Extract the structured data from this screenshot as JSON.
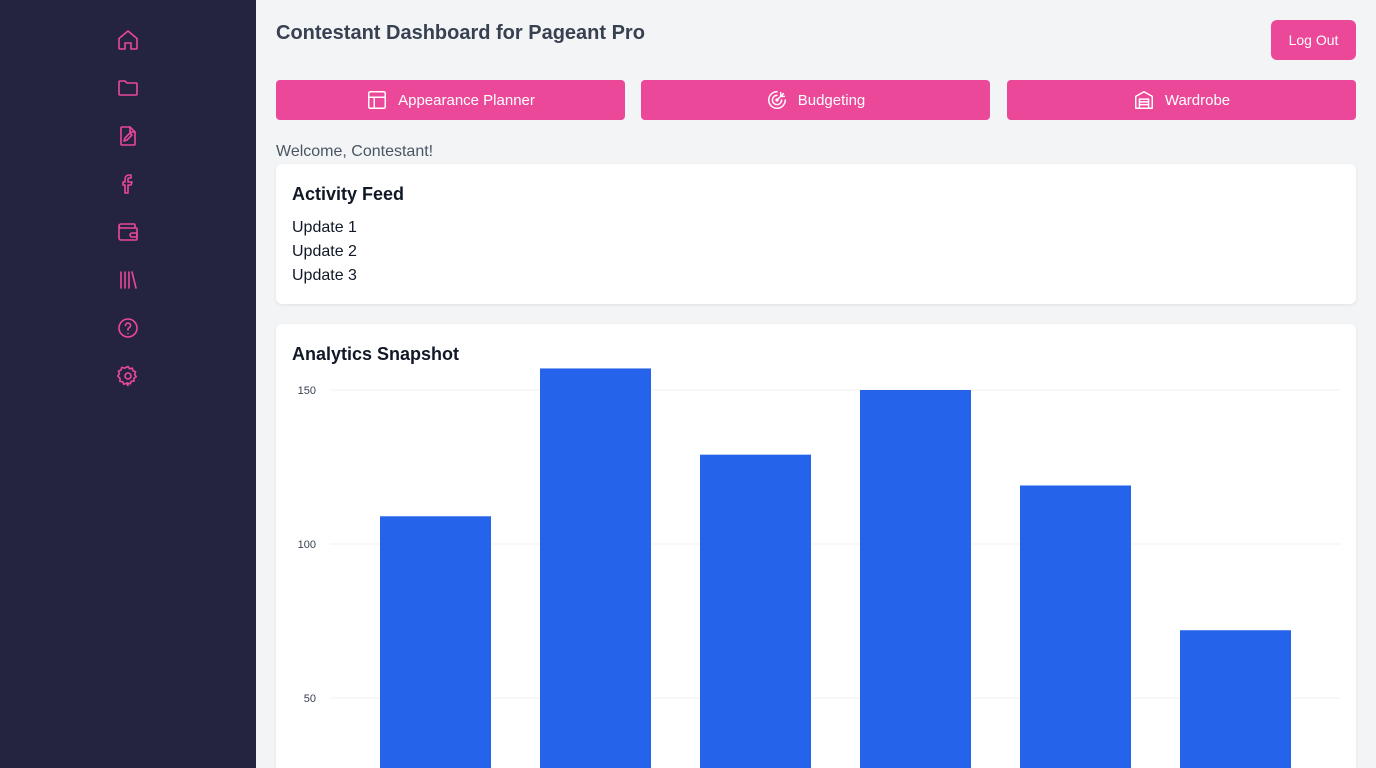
{
  "sidebar": {
    "items": [
      {
        "icon": "home-icon"
      },
      {
        "icon": "folder-icon"
      },
      {
        "icon": "file-edit-icon"
      },
      {
        "icon": "facebook-icon"
      },
      {
        "icon": "wallet-icon"
      },
      {
        "icon": "library-icon"
      },
      {
        "icon": "help-circle-icon"
      },
      {
        "icon": "settings-icon"
      }
    ],
    "icon_color": "#ec4899",
    "background": "#25243f"
  },
  "header": {
    "title": "Contestant Dashboard for Pageant Pro",
    "logout_label": "Log Out"
  },
  "nav": {
    "buttons": [
      {
        "label": "Appearance Planner",
        "icon": "layout-icon"
      },
      {
        "label": "Budgeting",
        "icon": "target-arrow-icon"
      },
      {
        "label": "Wardrobe",
        "icon": "warehouse-icon"
      }
    ],
    "accent": "#ec4899"
  },
  "welcome": "Welcome, Contestant!",
  "activity": {
    "title": "Activity Feed",
    "items": [
      "Update 1",
      "Update 2",
      "Update 3"
    ]
  },
  "analytics": {
    "title": "Analytics Snapshot"
  },
  "chart_data": {
    "type": "bar",
    "categories": [
      "",
      "",
      "",
      "",
      "",
      ""
    ],
    "values": [
      109,
      157,
      129,
      150,
      119,
      72
    ],
    "yticks": [
      50,
      100,
      150
    ],
    "ylim": [
      0,
      157
    ],
    "grid": true,
    "bar_color": "#2563eb"
  }
}
